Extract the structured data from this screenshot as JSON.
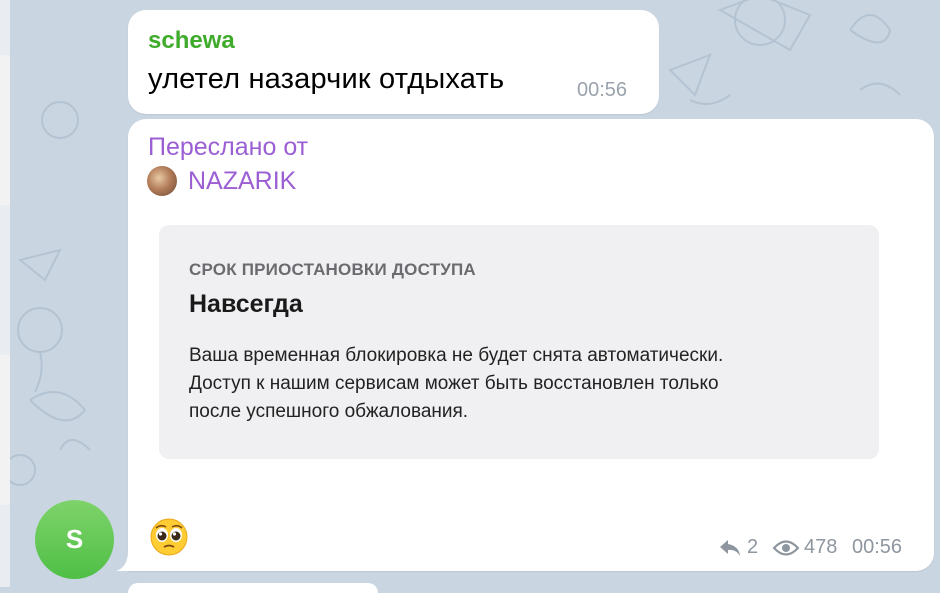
{
  "messages": [
    {
      "sender": "schewa",
      "text": "улетел назарчик отдыхать",
      "time": "00:56"
    },
    {
      "forwarded_label": "Переслано от",
      "forwarded_from": "NAZARIK",
      "card": {
        "title": "СРОК ПРИОСТАНОВКИ ДОСТУПА",
        "heading": "Навсегда",
        "lines": [
          "Ваша временная блокировка не будет снята автоматически.",
          "Доступ к нашим сервисам может быть восстановлен только",
          "после успешного обжалования."
        ]
      },
      "reaction_emoji": "pleading-face",
      "replies": "2",
      "views": "478",
      "time": "00:56"
    }
  ],
  "avatar": {
    "initial": "S",
    "color": "#5cc452"
  },
  "colors": {
    "sender_name": "#3fab2b",
    "forward_name": "#9b5fd3",
    "meta": "#8e969f",
    "background": "#c9d5e1"
  }
}
